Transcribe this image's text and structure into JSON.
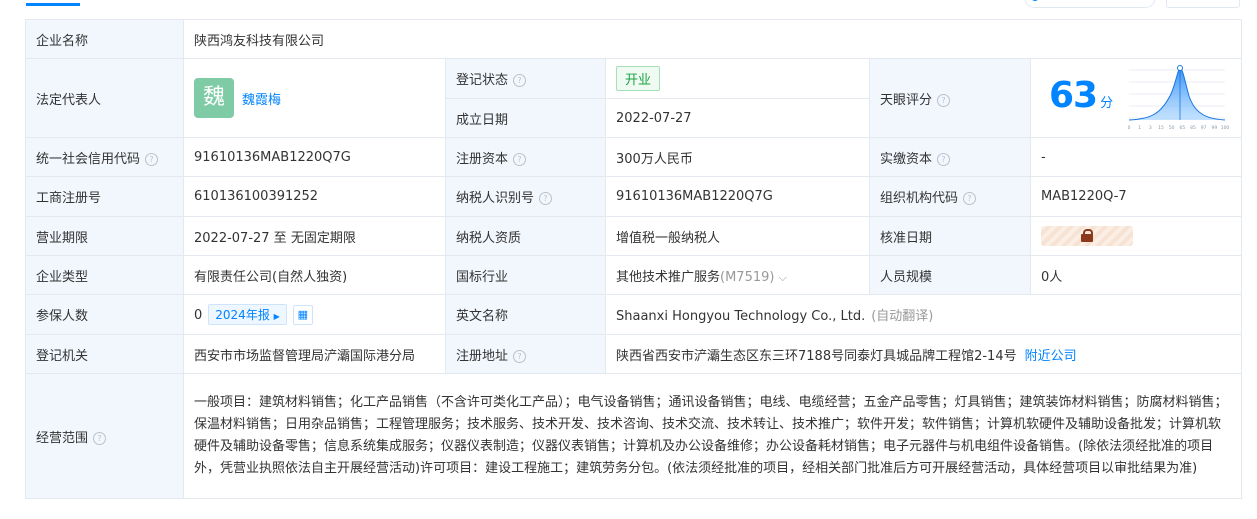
{
  "company": {
    "name_label": "企业名称",
    "name": "陕西鸿友科技有限公司",
    "legal_rep_label": "法定代表人",
    "legal_rep_avatar_char": "魏",
    "legal_rep_name": "魏霞梅",
    "reg_status_label": "登记状态",
    "reg_status": "开业",
    "established_label": "成立日期",
    "established": "2022-07-27",
    "score_label": "天眼评分",
    "score": "63",
    "score_unit": "分",
    "credit_code_label": "统一社会信用代码",
    "credit_code": "91610136MAB1220Q7G",
    "reg_capital_label": "注册资本",
    "reg_capital": "300万人民币",
    "paid_capital_label": "实缴资本",
    "paid_capital": "-",
    "biz_reg_no_label": "工商注册号",
    "biz_reg_no": "610136100391252",
    "taxpayer_id_label": "纳税人识别号",
    "taxpayer_id": "91610136MAB1220Q7G",
    "org_code_label": "组织机构代码",
    "org_code": "MAB1220Q-7",
    "term_label": "营业期限",
    "term": "2022-07-27 至 无固定期限",
    "taxpayer_qual_label": "纳税人资质",
    "taxpayer_qual": "增值税一般纳税人",
    "approval_date_label": "核准日期",
    "type_label": "企业类型",
    "type": "有限责任公司(自然人独资)",
    "industry_label": "国标行业",
    "industry": "其他技术推广服务",
    "industry_code": "(M7519)",
    "staff_label": "人员规模",
    "staff": "0人",
    "insured_label": "参保人数",
    "insured": "0",
    "insured_report": "2024年报",
    "en_name_label": "英文名称",
    "en_name": "Shaanxi Hongyou Technology Co., Ltd.",
    "en_name_note": "(自动翻译)",
    "authority_label": "登记机关",
    "authority": "西安市市场监督管理局浐灞国际港分局",
    "address_label": "注册地址",
    "address": "陕西省西安市浐灞生态区东三环7188号同泰灯具城品牌工程馆2-14号",
    "nearby_link": "附近公司",
    "scope_label": "经营范围",
    "scope": "一般项目：建筑材料销售；化工产品销售（不含许可类化工产品）；电气设备销售；通讯设备销售；电线、电缆经营；五金产品零售；灯具销售；建筑装饰材料销售；防腐材料销售；保温材料销售；日用杂品销售；工程管理服务；技术服务、技术开发、技术咨询、技术交流、技术转让、技术推广；软件开发；软件销售；计算机软硬件及辅助设备批发；计算机软硬件及辅助设备零售；信息系统集成服务；仪器仪表制造；仪器仪表销售；计算机及办公设备维修；办公设备耗材销售；电子元器件与机电组件设备销售。(除依法须经批准的项目外，凭营业执照依法自主开展经营活动)许可项目：建设工程施工；建筑劳务分包。(依法须经批准的项目，经相关部门批准后方可开展经营活动，具体经营项目以审批结果为准)"
  },
  "score_chart": {
    "x_ticks": [
      "0",
      "1",
      "3",
      "15",
      "50",
      "65",
      "85",
      "97",
      "99",
      "100"
    ]
  },
  "icons": {
    "help": "question-circle-icon",
    "lock": "lock-icon",
    "chevron": "chevron-down-icon",
    "chart": "bar-chart-icon"
  },
  "colors": {
    "accent": "#0084ff",
    "label_bg": "#f2f7fe",
    "status_green": "#19a33f"
  }
}
